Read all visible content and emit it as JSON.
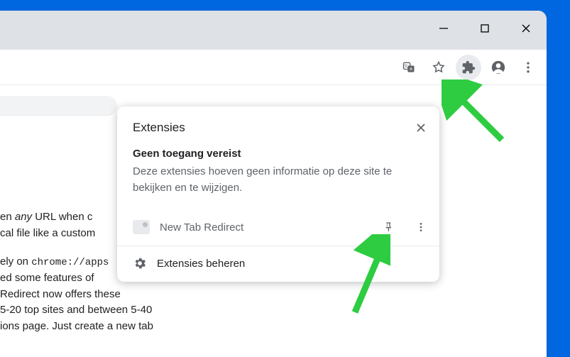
{
  "window": {
    "minimize": "—",
    "maximize": "□",
    "close": "✕"
  },
  "toolbar": {
    "translate_icon": "translate-icon",
    "star_icon": "star-icon",
    "extensions_icon": "puzzle-icon",
    "profile_icon": "profile-icon",
    "menu_icon": "menu-icon"
  },
  "popup": {
    "title": "Extensies",
    "close": "✕",
    "subheading": "Geen toegang vereist",
    "description": "Deze extensies hoeven geen informatie op deze site te bekijken en te wijzigen.",
    "extension": {
      "name": "New Tab Redirect",
      "pin_icon": "pin-icon",
      "menu_icon": "more-icon"
    },
    "manage": "Extensies beheren"
  },
  "page": {
    "p1_pre": "en ",
    "p1_em": "any",
    "p1_post": " URL when c",
    "p1_line2": "cal file like a custom",
    "p2_line1_pre": "ely on ",
    "p2_line1_code": "chrome://apps",
    "p2_line2": "ed some features of ",
    "p2_line3": " Redirect now offers these",
    "p2_line4": " 5-20 top sites and between 5-40",
    "p2_line5": "ions page. Just create a new tab"
  }
}
